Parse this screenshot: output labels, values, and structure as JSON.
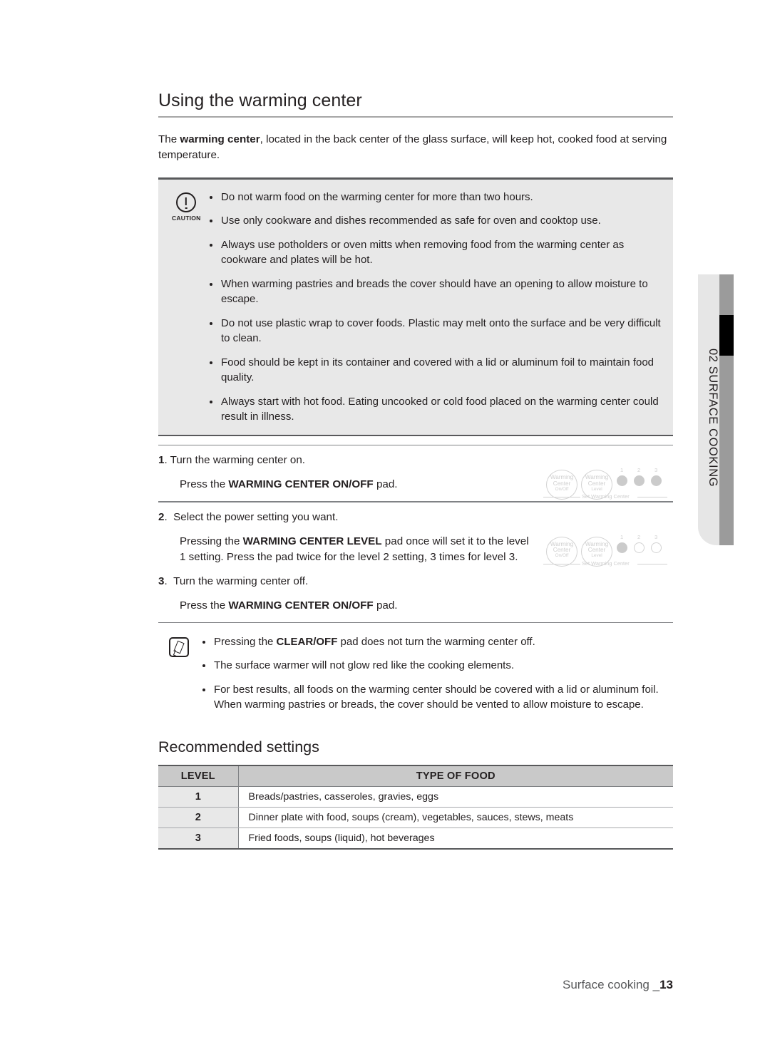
{
  "side_tab": {
    "label": "02  SURFACE COOKING"
  },
  "section": {
    "title": "Using the warming center",
    "intro_before": "The ",
    "intro_bold": "warming center",
    "intro_after": ", located in the back center of the glass surface, will keep hot, cooked food at serving temperature."
  },
  "caution": {
    "icon_label": "CAUTION",
    "bullets": [
      "Do not warm food on the warming center for more than two hours.",
      "Use only cookware and dishes recommended as safe for oven and cooktop use.",
      "Always use potholders or oven mitts when removing food from the warming center as cookware and plates will be hot.",
      "When warming pastries and breads the cover should have an opening to allow moisture to escape.",
      "Do not use plastic wrap to cover foods. Plastic may melt onto the surface and be very difficult to clean.",
      "Food should be kept in its container and covered with a lid or aluminum foil to maintain food quality.",
      "Always start with hot food. Eating uncooked or cold food placed on the warming center could result in illness."
    ]
  },
  "steps": [
    {
      "num": "1",
      "heading": "Turn the warming center on.",
      "body_before": "Press the ",
      "body_bold": "WARMING CENTER ON/OFF",
      "body_after": " pad.",
      "graphic": {
        "oval1": [
          "Warming",
          "Center",
          "On/Off"
        ],
        "oval2": [
          "Warming",
          "Center",
          "Level"
        ],
        "dot_numbers": [
          "1",
          "2",
          "3"
        ],
        "dots_filled": [
          true,
          true,
          true
        ],
        "set_label": "Set  Warming Center"
      }
    },
    {
      "num": "2",
      "heading": "Select the power setting you want.",
      "body_before": "Pressing the ",
      "body_bold": "WARMING CENTER LEVEL",
      "body_after": " pad once will set it to the level 1 setting. Press the pad twice for the level 2 setting, 3 times for level 3.",
      "graphic": {
        "oval1": [
          "Warming",
          "Center",
          "On/Off"
        ],
        "oval2": [
          "Warming",
          "Center",
          "Level"
        ],
        "dot_numbers": [
          "1",
          "2",
          "3"
        ],
        "dots_filled": [
          true,
          false,
          false
        ],
        "set_label": "Set  Warming Center"
      }
    },
    {
      "num": "3",
      "heading": "Turn the warming center off.",
      "body_before": "Press the ",
      "body_bold": "WARMING CENTER ON/OFF",
      "body_after": " pad."
    }
  ],
  "note": {
    "bullets": [
      {
        "before": "Pressing the ",
        "bold": "CLEAR/OFF",
        "after": " pad does not turn the warming center off."
      },
      {
        "before": "The surface warmer will not glow red like the cooking elements.",
        "bold": "",
        "after": ""
      },
      {
        "before": "For best results, all foods on the warming center should be covered with a lid or aluminum foil. When warming pastries or breads, the cover should be vented to allow moisture to escape.",
        "bold": "",
        "after": ""
      }
    ]
  },
  "recommended": {
    "title": "Recommended settings",
    "columns": [
      "LEVEL",
      "TYPE OF FOOD"
    ],
    "rows": [
      {
        "level": "1",
        "food": "Breads/pastries, casseroles, gravies, eggs"
      },
      {
        "level": "2",
        "food": "Dinner plate with food, soups (cream), vegetables, sauces, stews, meats"
      },
      {
        "level": "3",
        "food": "Fried foods, soups (liquid), hot beverages"
      }
    ]
  },
  "footer": {
    "text": "Surface cooking _",
    "page": "13"
  },
  "colors": {
    "tab_light": "#e6e6e6",
    "tab_bar": "#9b9b9b",
    "tab_marker": "#000000",
    "panel_bg": "#e8e8e8",
    "table_header": "#c9c9c9",
    "rule_dark": "#58595b",
    "graphic_gray": "#d3d3d3"
  }
}
